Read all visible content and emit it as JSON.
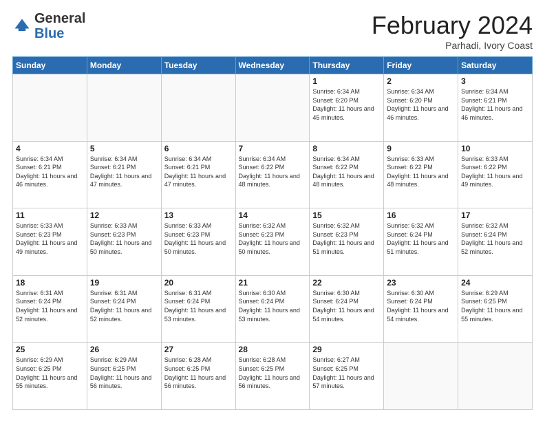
{
  "header": {
    "logo_general": "General",
    "logo_blue": "Blue",
    "month_title": "February 2024",
    "subtitle": "Parhadi, Ivory Coast"
  },
  "days_of_week": [
    "Sunday",
    "Monday",
    "Tuesday",
    "Wednesday",
    "Thursday",
    "Friday",
    "Saturday"
  ],
  "weeks": [
    [
      {
        "day": "",
        "info": ""
      },
      {
        "day": "",
        "info": ""
      },
      {
        "day": "",
        "info": ""
      },
      {
        "day": "",
        "info": ""
      },
      {
        "day": "1",
        "info": "Sunrise: 6:34 AM\nSunset: 6:20 PM\nDaylight: 11 hours\nand 45 minutes."
      },
      {
        "day": "2",
        "info": "Sunrise: 6:34 AM\nSunset: 6:20 PM\nDaylight: 11 hours\nand 46 minutes."
      },
      {
        "day": "3",
        "info": "Sunrise: 6:34 AM\nSunset: 6:21 PM\nDaylight: 11 hours\nand 46 minutes."
      }
    ],
    [
      {
        "day": "4",
        "info": "Sunrise: 6:34 AM\nSunset: 6:21 PM\nDaylight: 11 hours\nand 46 minutes."
      },
      {
        "day": "5",
        "info": "Sunrise: 6:34 AM\nSunset: 6:21 PM\nDaylight: 11 hours\nand 47 minutes."
      },
      {
        "day": "6",
        "info": "Sunrise: 6:34 AM\nSunset: 6:21 PM\nDaylight: 11 hours\nand 47 minutes."
      },
      {
        "day": "7",
        "info": "Sunrise: 6:34 AM\nSunset: 6:22 PM\nDaylight: 11 hours\nand 48 minutes."
      },
      {
        "day": "8",
        "info": "Sunrise: 6:34 AM\nSunset: 6:22 PM\nDaylight: 11 hours\nand 48 minutes."
      },
      {
        "day": "9",
        "info": "Sunrise: 6:33 AM\nSunset: 6:22 PM\nDaylight: 11 hours\nand 48 minutes."
      },
      {
        "day": "10",
        "info": "Sunrise: 6:33 AM\nSunset: 6:22 PM\nDaylight: 11 hours\nand 49 minutes."
      }
    ],
    [
      {
        "day": "11",
        "info": "Sunrise: 6:33 AM\nSunset: 6:23 PM\nDaylight: 11 hours\nand 49 minutes."
      },
      {
        "day": "12",
        "info": "Sunrise: 6:33 AM\nSunset: 6:23 PM\nDaylight: 11 hours\nand 50 minutes."
      },
      {
        "day": "13",
        "info": "Sunrise: 6:33 AM\nSunset: 6:23 PM\nDaylight: 11 hours\nand 50 minutes."
      },
      {
        "day": "14",
        "info": "Sunrise: 6:32 AM\nSunset: 6:23 PM\nDaylight: 11 hours\nand 50 minutes."
      },
      {
        "day": "15",
        "info": "Sunrise: 6:32 AM\nSunset: 6:23 PM\nDaylight: 11 hours\nand 51 minutes."
      },
      {
        "day": "16",
        "info": "Sunrise: 6:32 AM\nSunset: 6:24 PM\nDaylight: 11 hours\nand 51 minutes."
      },
      {
        "day": "17",
        "info": "Sunrise: 6:32 AM\nSunset: 6:24 PM\nDaylight: 11 hours\nand 52 minutes."
      }
    ],
    [
      {
        "day": "18",
        "info": "Sunrise: 6:31 AM\nSunset: 6:24 PM\nDaylight: 11 hours\nand 52 minutes."
      },
      {
        "day": "19",
        "info": "Sunrise: 6:31 AM\nSunset: 6:24 PM\nDaylight: 11 hours\nand 52 minutes."
      },
      {
        "day": "20",
        "info": "Sunrise: 6:31 AM\nSunset: 6:24 PM\nDaylight: 11 hours\nand 53 minutes."
      },
      {
        "day": "21",
        "info": "Sunrise: 6:30 AM\nSunset: 6:24 PM\nDaylight: 11 hours\nand 53 minutes."
      },
      {
        "day": "22",
        "info": "Sunrise: 6:30 AM\nSunset: 6:24 PM\nDaylight: 11 hours\nand 54 minutes."
      },
      {
        "day": "23",
        "info": "Sunrise: 6:30 AM\nSunset: 6:24 PM\nDaylight: 11 hours\nand 54 minutes."
      },
      {
        "day": "24",
        "info": "Sunrise: 6:29 AM\nSunset: 6:25 PM\nDaylight: 11 hours\nand 55 minutes."
      }
    ],
    [
      {
        "day": "25",
        "info": "Sunrise: 6:29 AM\nSunset: 6:25 PM\nDaylight: 11 hours\nand 55 minutes."
      },
      {
        "day": "26",
        "info": "Sunrise: 6:29 AM\nSunset: 6:25 PM\nDaylight: 11 hours\nand 56 minutes."
      },
      {
        "day": "27",
        "info": "Sunrise: 6:28 AM\nSunset: 6:25 PM\nDaylight: 11 hours\nand 56 minutes."
      },
      {
        "day": "28",
        "info": "Sunrise: 6:28 AM\nSunset: 6:25 PM\nDaylight: 11 hours\nand 56 minutes."
      },
      {
        "day": "29",
        "info": "Sunrise: 6:27 AM\nSunset: 6:25 PM\nDaylight: 11 hours\nand 57 minutes."
      },
      {
        "day": "",
        "info": ""
      },
      {
        "day": "",
        "info": ""
      }
    ]
  ]
}
